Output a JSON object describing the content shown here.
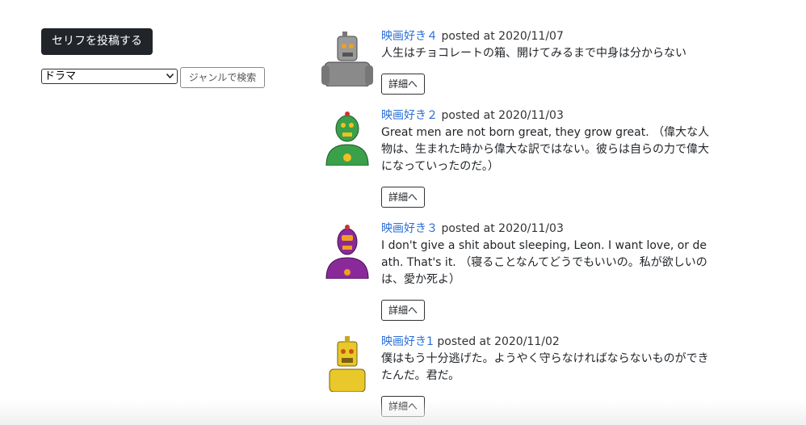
{
  "controls": {
    "post_button_label": "セリフを投稿する",
    "genre_selected": "ドラマ",
    "search_button_label": "ジャンルで検索"
  },
  "posts": [
    {
      "author": "映画好き４",
      "posted": "posted at 2020/11/07",
      "quote": "人生はチョコレートの箱、開けてみるまで中身は分からない",
      "detail_label": "詳細へ",
      "avatar_icon": "gray-robot-icon",
      "avatar_color": "#9a9a9a"
    },
    {
      "author": "映画好き２",
      "posted": "posted at 2020/11/03",
      "quote": "Great men are not born great, they grow great. （偉大な人物は、生まれた時から偉大な訳ではない。彼らは自らの力で偉大になっていったのだ。）",
      "detail_label": "詳細へ",
      "avatar_icon": "green-robot-icon",
      "avatar_color": "#3aa04a"
    },
    {
      "author": "映画好き３",
      "posted": "posted at 2020/11/03",
      "quote": "I don't give a shit about sleeping, Leon. I want love, or death. That's it. （寝ることなんてどうでもいいの。私が欲しいのは、愛か死よ）",
      "detail_label": "詳細へ",
      "avatar_icon": "purple-robot-icon",
      "avatar_color": "#8a2a9a"
    },
    {
      "author": "映画好き1",
      "posted": "posted at 2020/11/02",
      "quote": "僕はもう十分逃げた。ようやく守らなければならないものができたんだ。君だ。",
      "detail_label": "詳細へ",
      "avatar_icon": "yellow-robot-icon",
      "avatar_color": "#e8c82a"
    }
  ]
}
